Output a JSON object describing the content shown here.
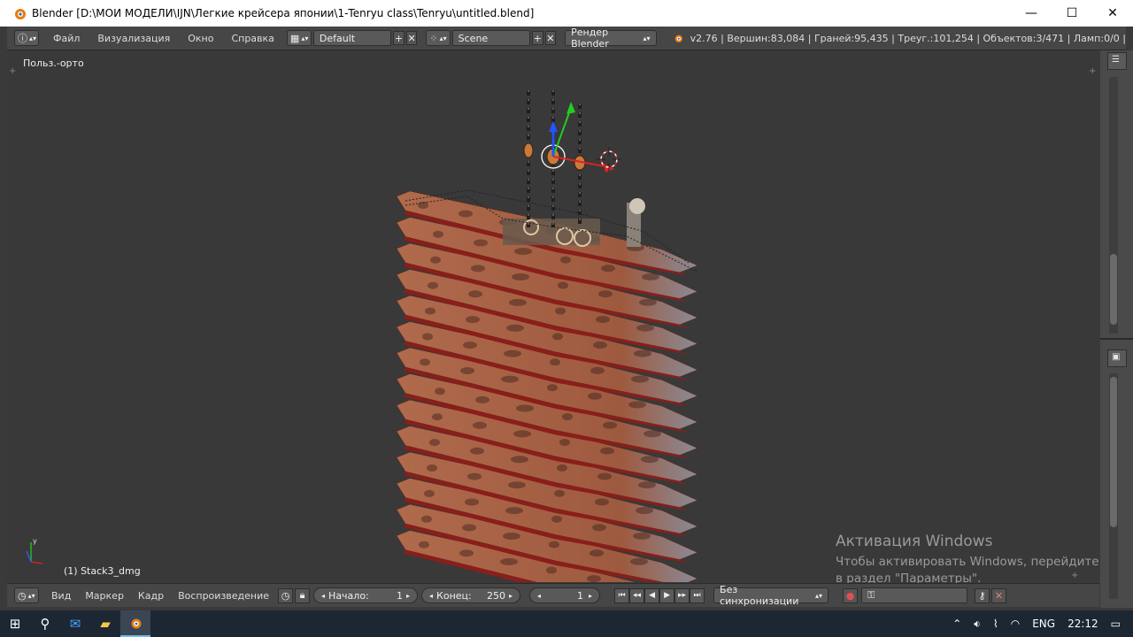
{
  "window": {
    "title": "Blender [D:\\МОИ МОДЕЛИ\\IJN\\Легкие крейсера японии\\1-Tenryu class\\Tenryu\\untitled.blend]",
    "minimize": "—",
    "maximize": "☐",
    "close": "✕"
  },
  "menu": {
    "file": "Файл",
    "render": "Визуализация",
    "window": "Окно",
    "help": "Справка"
  },
  "layout": {
    "screen": "Default",
    "scene": "Scene",
    "engine": "Рендер Blender"
  },
  "stats": "v2.76 | Вершин:83,084 | Граней:95,435 | Треуг.:101,254 | Объектов:3/471 | Ламп:0/0 |",
  "viewport": {
    "view_name": "Польз.-орто",
    "active_object": "(1) Stack3_dmg"
  },
  "timeline": {
    "view": "Вид",
    "marker": "Маркер",
    "frame": "Кадр",
    "playback": "Воспроизведение",
    "start_label": "Начало:",
    "start_value": "1",
    "end_label": "Конец:",
    "end_value": "250",
    "current_frame": "1",
    "sync": "Без синхронизации"
  },
  "activation": {
    "title": "Активация Windows",
    "text": "Чтобы активировать Windows, перейдите в раздел \"Параметры\"."
  },
  "taskbar": {
    "lang": "ENG",
    "time": "22:12"
  },
  "colors": {
    "hull": "#b46a4a",
    "hull_dark": "#7a3c2a",
    "viewport_bg": "#393939",
    "taskbar": "#1c2733"
  }
}
